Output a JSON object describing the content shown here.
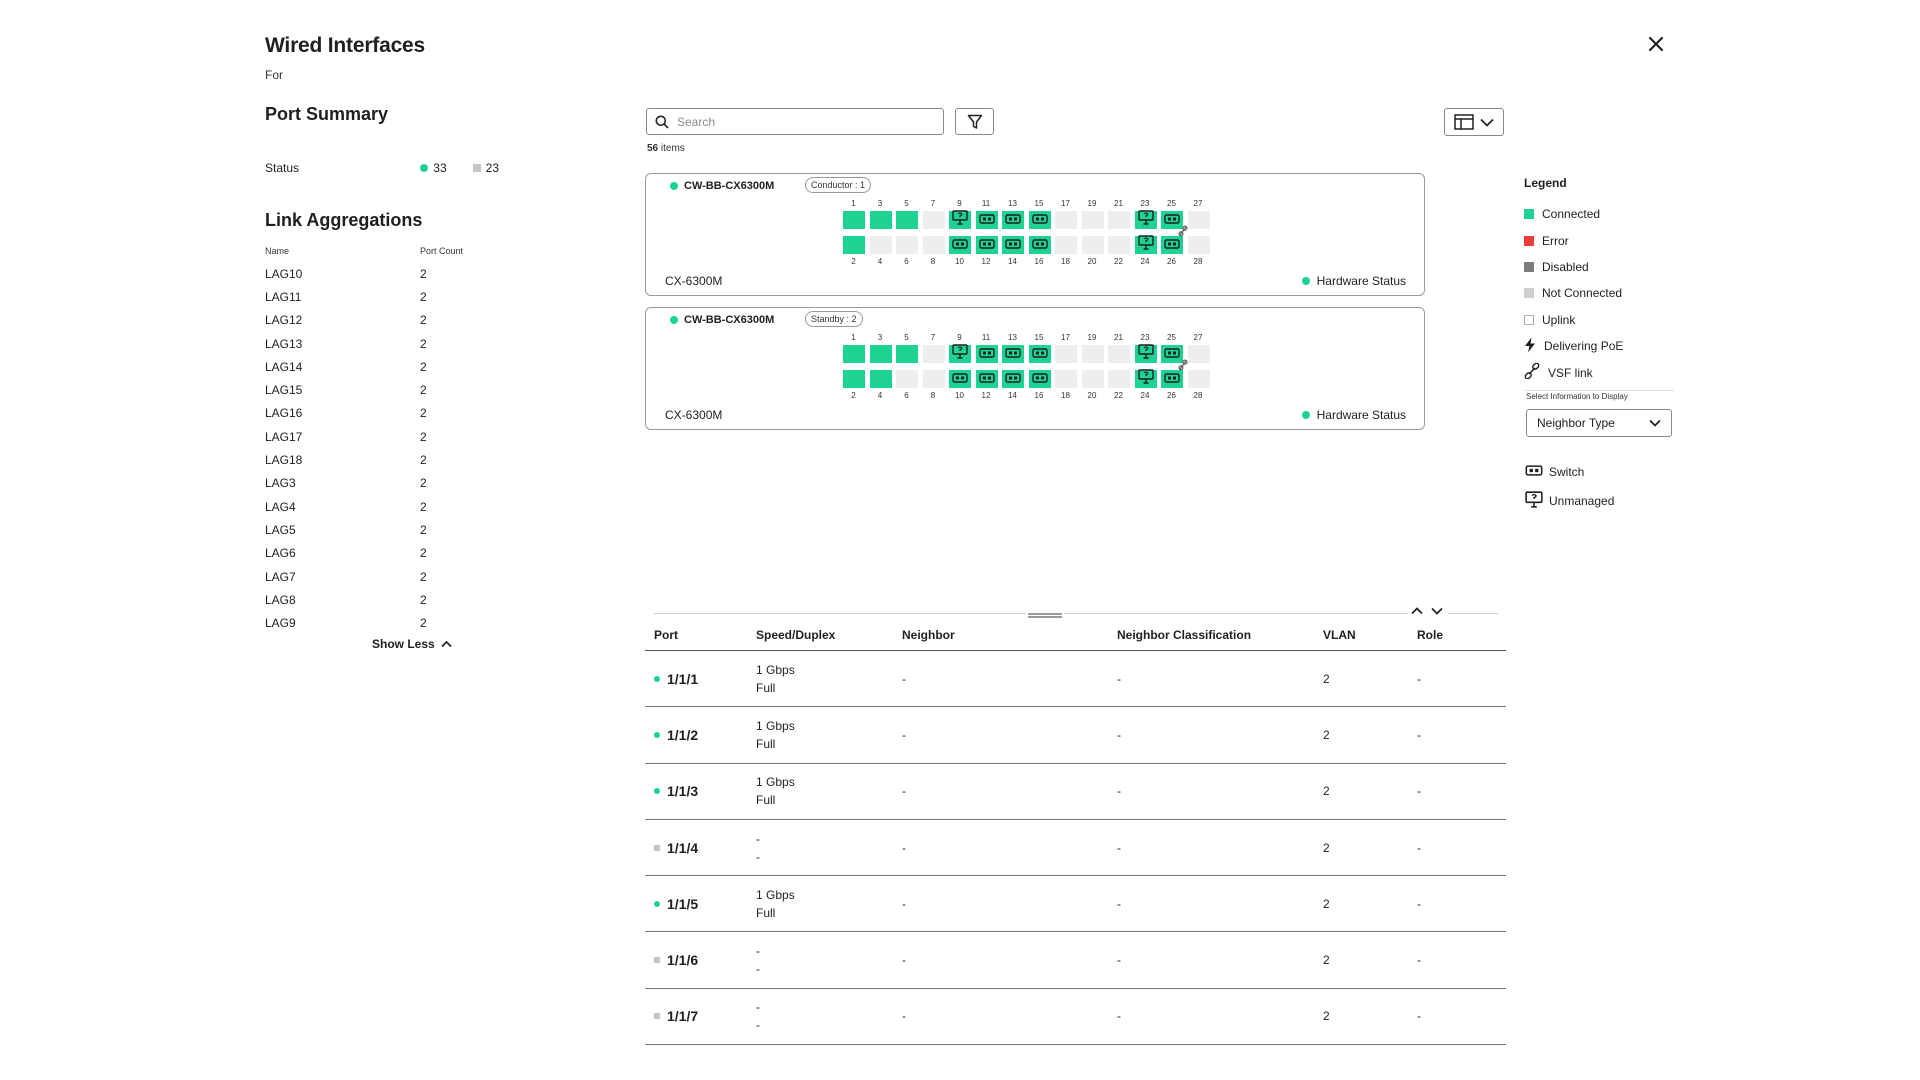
{
  "header": {
    "title": "Wired Interfaces",
    "subtitle": "For"
  },
  "port_summary": {
    "title": "Port Summary",
    "status_label": "Status",
    "connected_count": "33",
    "not_connected_count": "23"
  },
  "link_aggregations": {
    "title": "Link Aggregations",
    "col_name": "Name",
    "col_port_count": "Port Count",
    "rows": [
      {
        "name": "LAG10",
        "count": "2"
      },
      {
        "name": "LAG11",
        "count": "2"
      },
      {
        "name": "LAG12",
        "count": "2"
      },
      {
        "name": "LAG13",
        "count": "2"
      },
      {
        "name": "LAG14",
        "count": "2"
      },
      {
        "name": "LAG15",
        "count": "2"
      },
      {
        "name": "LAG16",
        "count": "2"
      },
      {
        "name": "LAG17",
        "count": "2"
      },
      {
        "name": "LAG18",
        "count": "2"
      },
      {
        "name": "LAG3",
        "count": "2"
      },
      {
        "name": "LAG4",
        "count": "2"
      },
      {
        "name": "LAG5",
        "count": "2"
      },
      {
        "name": "LAG6",
        "count": "2"
      },
      {
        "name": "LAG7",
        "count": "2"
      },
      {
        "name": "LAG8",
        "count": "2"
      },
      {
        "name": "LAG9",
        "count": "2"
      }
    ],
    "show_less": "Show Less"
  },
  "toolbar": {
    "search_placeholder": "Search",
    "items_count": "56",
    "items_label": "items"
  },
  "switches": [
    {
      "name": "CW-BB-CX6300M",
      "role": "Conductor : 1",
      "model": "CX-6300M",
      "hw_status": "Hardware Status",
      "top_numbers": [
        "1",
        "3",
        "5",
        "7",
        "9",
        "11",
        "13",
        "15",
        "17",
        "19",
        "21",
        "23",
        "25",
        "27"
      ],
      "bottom_numbers": [
        "2",
        "4",
        "6",
        "8",
        "10",
        "12",
        "14",
        "16",
        "18",
        "20",
        "22",
        "24",
        "26",
        "28"
      ],
      "top_ports": [
        "on",
        "on",
        "on",
        "off",
        "unmanaged",
        "switch",
        "switch",
        "switch",
        "off",
        "off",
        "off",
        "unmanaged",
        "switch",
        "off"
      ],
      "bottom_ports": [
        "on",
        "off",
        "off",
        "off",
        "switch",
        "switch",
        "switch",
        "switch",
        "off",
        "off",
        "off",
        "unmanaged",
        "switch",
        "off"
      ]
    },
    {
      "name": "CW-BB-CX6300M",
      "role": "Standby : 2",
      "model": "CX-6300M",
      "hw_status": "Hardware Status",
      "top_numbers": [
        "1",
        "3",
        "5",
        "7",
        "9",
        "11",
        "13",
        "15",
        "17",
        "19",
        "21",
        "23",
        "25",
        "27"
      ],
      "bottom_numbers": [
        "2",
        "4",
        "6",
        "8",
        "10",
        "12",
        "14",
        "16",
        "18",
        "20",
        "22",
        "24",
        "26",
        "28"
      ],
      "top_ports": [
        "on",
        "on",
        "on",
        "off",
        "unmanaged",
        "switch",
        "switch",
        "switch",
        "off",
        "off",
        "off",
        "unmanaged",
        "switch",
        "off"
      ],
      "bottom_ports": [
        "on",
        "on",
        "off",
        "off",
        "switch",
        "switch",
        "switch",
        "switch",
        "off",
        "off",
        "off",
        "unmanaged",
        "switch",
        "off"
      ]
    }
  ],
  "legend": {
    "title": "Legend",
    "items": [
      {
        "label": "Connected",
        "color": "#1ed392",
        "kind": "square"
      },
      {
        "label": "Error",
        "color": "#ee3b3b",
        "kind": "square"
      },
      {
        "label": "Disabled",
        "color": "#7d7d7d",
        "kind": "square"
      },
      {
        "label": "Not Connected",
        "color": "#cfcfcf",
        "kind": "square"
      },
      {
        "label": "Uplink",
        "color": "#ffffff",
        "kind": "outline"
      },
      {
        "label": "Delivering PoE",
        "kind": "bolt"
      },
      {
        "label": "VSF link",
        "kind": "link"
      }
    ],
    "select_label": "Select Information to Display",
    "select_value": "Neighbor Type",
    "neighbor_types": [
      {
        "label": "Switch",
        "kind": "switch"
      },
      {
        "label": "Unmanaged",
        "kind": "unmanaged"
      }
    ]
  },
  "table": {
    "headers": [
      "Port",
      "Speed/Duplex",
      "Neighbor",
      "Neighbor Classification",
      "VLAN",
      "Role"
    ],
    "rows": [
      {
        "port": "1/1/1",
        "status": "up",
        "speed": "1 Gbps",
        "duplex": "Full",
        "neighbor": "-",
        "classification": "-",
        "vlan": "2",
        "role": "-"
      },
      {
        "port": "1/1/2",
        "status": "up",
        "speed": "1 Gbps",
        "duplex": "Full",
        "neighbor": "-",
        "classification": "-",
        "vlan": "2",
        "role": "-"
      },
      {
        "port": "1/1/3",
        "status": "up",
        "speed": "1 Gbps",
        "duplex": "Full",
        "neighbor": "-",
        "classification": "-",
        "vlan": "2",
        "role": "-"
      },
      {
        "port": "1/1/4",
        "status": "down",
        "speed": "-",
        "duplex": "-",
        "neighbor": "-",
        "classification": "-",
        "vlan": "2",
        "role": "-"
      },
      {
        "port": "1/1/5",
        "status": "up",
        "speed": "1 Gbps",
        "duplex": "Full",
        "neighbor": "-",
        "classification": "-",
        "vlan": "2",
        "role": "-"
      },
      {
        "port": "1/1/6",
        "status": "down",
        "speed": "-",
        "duplex": "-",
        "neighbor": "-",
        "classification": "-",
        "vlan": "2",
        "role": "-"
      },
      {
        "port": "1/1/7",
        "status": "down",
        "speed": "-",
        "duplex": "-",
        "neighbor": "-",
        "classification": "-",
        "vlan": "2",
        "role": "-"
      }
    ]
  },
  "colors": {
    "connected": "#1ed392",
    "not_connected": "#c4c4c4",
    "port_off": "#eeeeee"
  }
}
